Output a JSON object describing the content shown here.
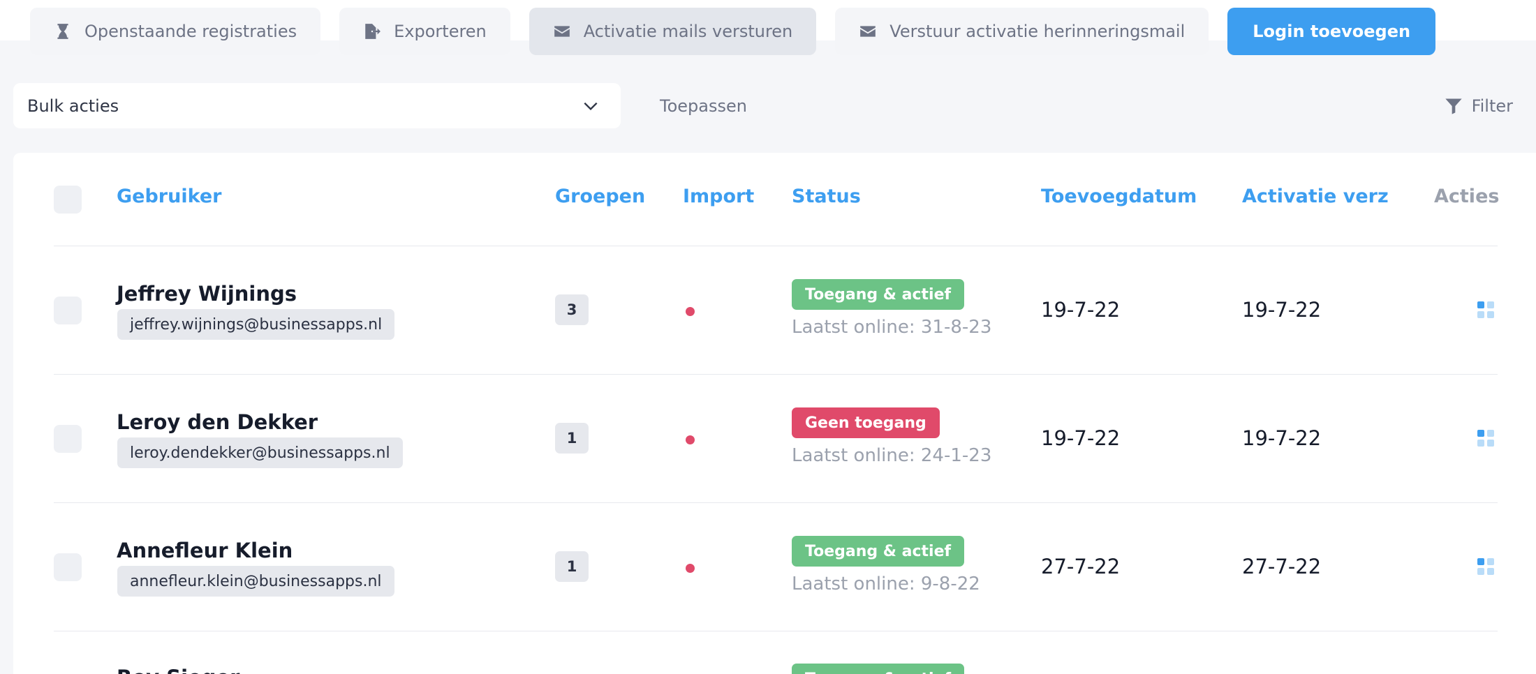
{
  "toolbar": {
    "buttons": [
      {
        "label": "Openstaande registraties",
        "icon": "hourglass-icon"
      },
      {
        "label": "Exporteren",
        "icon": "file-export-icon"
      },
      {
        "label": "Activatie mails versturen",
        "icon": "envelope-icon"
      },
      {
        "label": "Verstuur activatie herinneringsmail",
        "icon": "envelope-icon"
      },
      {
        "label": "Login toevoegen"
      }
    ]
  },
  "bulk": {
    "select_value": "Bulk acties",
    "apply_label": "Toepassen",
    "filter_label": "Filter"
  },
  "table": {
    "headers": {
      "user": "Gebruiker",
      "groups": "Groepen",
      "import": "Import",
      "status": "Status",
      "added": "Toevoegdatum",
      "activation": "Activatie verz",
      "actions": "Acties"
    },
    "rows": [
      {
        "name": "Jeffrey Wijnings",
        "email": "jeffrey.wijnings@businessapps.nl",
        "groups": "3",
        "status": "Toegang & actief",
        "last_online": "Laatst online: 31-8-23",
        "added": "19-7-22",
        "activation": "19-7-22"
      },
      {
        "name": "Leroy den Dekker",
        "email": "leroy.dendekker@businessapps.nl",
        "groups": "1",
        "status": "Geen toegang",
        "last_online": "Laatst online: 24-1-23",
        "added": "19-7-22",
        "activation": "19-7-22"
      },
      {
        "name": "Annefleur Klein",
        "email": "annefleur.klein@businessapps.nl",
        "groups": "1",
        "status": "Toegang & actief",
        "last_online": "Laatst online: 9-8-22",
        "added": "27-7-22",
        "activation": "27-7-22"
      },
      {
        "name": "Roy Sieger",
        "status": "Toegang & actief"
      }
    ]
  },
  "colors": {
    "accent": "#3d9ef0",
    "status_active": "#6cc386",
    "status_no_access": "#e04a6a",
    "import_dot": "#e04a6a"
  }
}
